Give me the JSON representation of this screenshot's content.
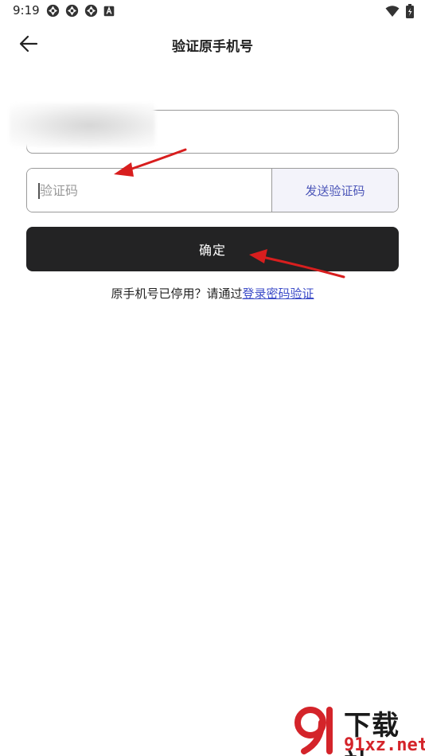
{
  "status_bar": {
    "time": "9:19",
    "left_icons": [
      "aperture-icon",
      "aperture-icon",
      "aperture-icon",
      "a-badge-icon"
    ],
    "right_icons": [
      "wifi-icon",
      "battery-icon"
    ]
  },
  "nav": {
    "title": "验证原手机号",
    "back_icon": "arrow-left-icon"
  },
  "phone_field": {
    "value": ""
  },
  "code_field": {
    "placeholder": "验证码",
    "value": "",
    "send_label": "发送验证码"
  },
  "confirm_label": "确定",
  "hint": {
    "prefix": "原手机号已停用？请通过",
    "link": "登录密码验证"
  },
  "watermark": {
    "top_text": "下载站",
    "bottom_text": "91xz.net"
  },
  "colors": {
    "primary_button": "#232324",
    "link": "#3c4cc8",
    "send_button_bg": "#f3f3fa",
    "send_button_text": "#4b55b8",
    "annotation_arrow": "#d81e1e",
    "watermark_red": "#d4242a"
  }
}
